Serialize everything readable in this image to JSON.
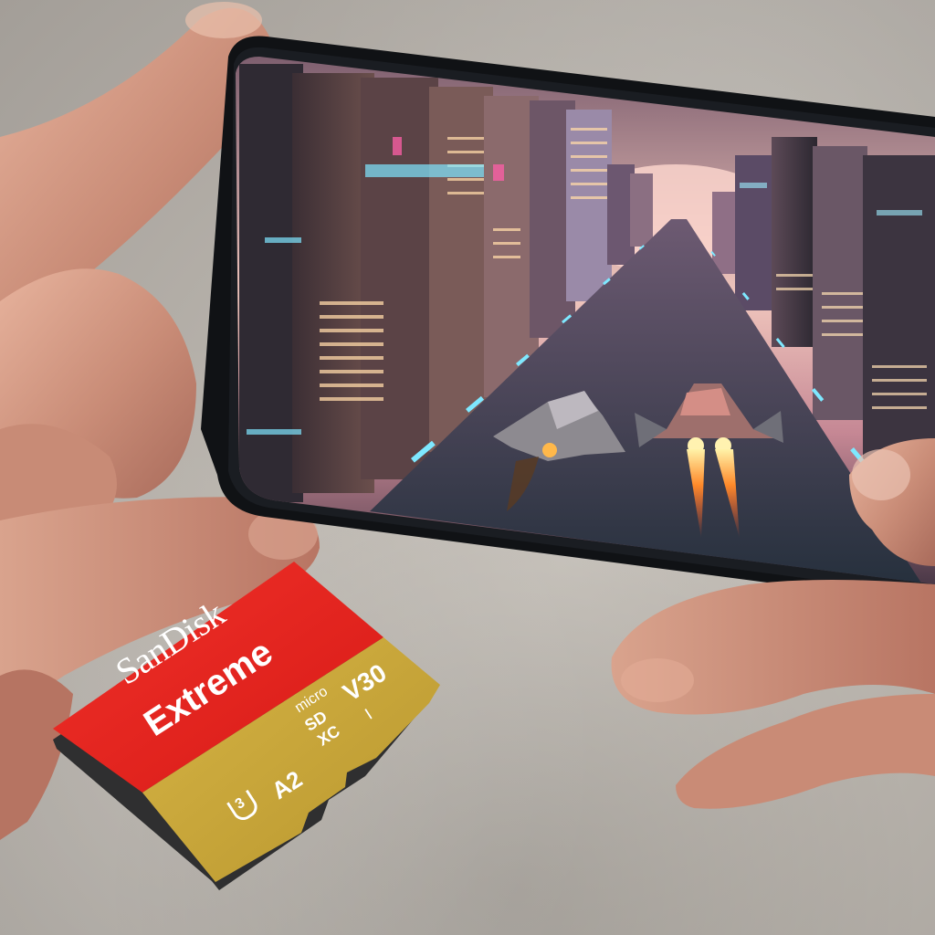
{
  "card": {
    "brand": "SanDisk",
    "product": "Extreme",
    "micro": "micro",
    "sd": "SD",
    "xc": "XC",
    "roman": "I",
    "speed_class": "V30",
    "uhs_class": "3",
    "app_class": "A2",
    "colors": {
      "red": "#e5231f",
      "gold": "#c7a338",
      "edge": "#3a3a3a"
    }
  },
  "phone": {
    "screen_content": "racing-game-city-scene",
    "colors": {
      "body": "#121417",
      "sky": "#e9b9b4",
      "road": "#3e4756",
      "lights": "#6fe3ff"
    }
  },
  "background": {
    "colors": {
      "wall": "#bdb8b1"
    }
  }
}
